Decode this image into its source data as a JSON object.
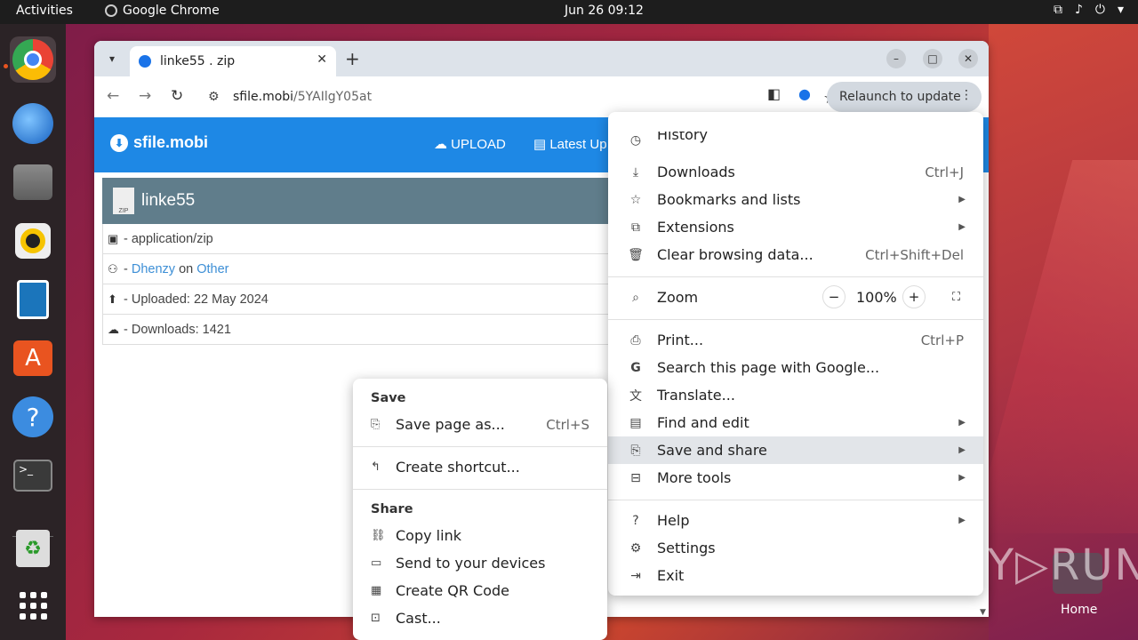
{
  "topbar": {
    "activities": "Activities",
    "app_name": "Google Chrome",
    "clock": "Jun 26  09:12"
  },
  "dock": {
    "items": [
      "chrome-icon",
      "thunderbird-icon",
      "files-icon",
      "rhythmbox-icon",
      "writer-icon",
      "appcenter-icon",
      "help-icon",
      "terminal-icon",
      "trash-icon",
      "apps-grid-icon"
    ]
  },
  "browser": {
    "tab_title": "linke55 . zip",
    "url_host": "sfile.mobi",
    "url_path": "/5YAIlgY05at",
    "relaunch_label": "Relaunch to update"
  },
  "site": {
    "logo": "sfile.mobi",
    "nav_upload": "UPLOAD",
    "nav_latest": "Latest Up",
    "file_name": "linke55",
    "zip_label": "ZIP",
    "mime": "- application/zip",
    "uploader_prefix": "- ",
    "uploader": "Dhenzy",
    "on_text": "on",
    "category": "Other",
    "uploaded": "- Uploaded: 22 May 2024",
    "downloads": "- Downloads: 1421"
  },
  "menu": {
    "history": "History",
    "downloads": "Downloads",
    "downloads_sc": "Ctrl+J",
    "bookmarks": "Bookmarks and lists",
    "extensions": "Extensions",
    "clear": "Clear browsing data...",
    "clear_sc": "Ctrl+Shift+Del",
    "zoom": "Zoom",
    "zoom_minus": "−",
    "zoom_value": "100%",
    "zoom_plus": "+",
    "print": "Print...",
    "print_sc": "Ctrl+P",
    "search_google": "Search this page with Google...",
    "translate": "Translate...",
    "find_edit": "Find and edit",
    "save_share": "Save and share",
    "more_tools": "More tools",
    "help": "Help",
    "settings": "Settings",
    "exit": "Exit"
  },
  "submenu": {
    "save_header": "Save",
    "save_page": "Save page as...",
    "save_page_sc": "Ctrl+S",
    "create_shortcut": "Create shortcut...",
    "share_header": "Share",
    "copy_link": "Copy link",
    "send_devices": "Send to your devices",
    "qr_code": "Create QR Code",
    "cast": "Cast..."
  },
  "desktop": {
    "home_label": "Home",
    "watermark": "ANY▷RUN"
  },
  "colors": {
    "site_header": "#1e88e5",
    "file_header": "#607d8b",
    "accent_orange": "#e95420"
  }
}
